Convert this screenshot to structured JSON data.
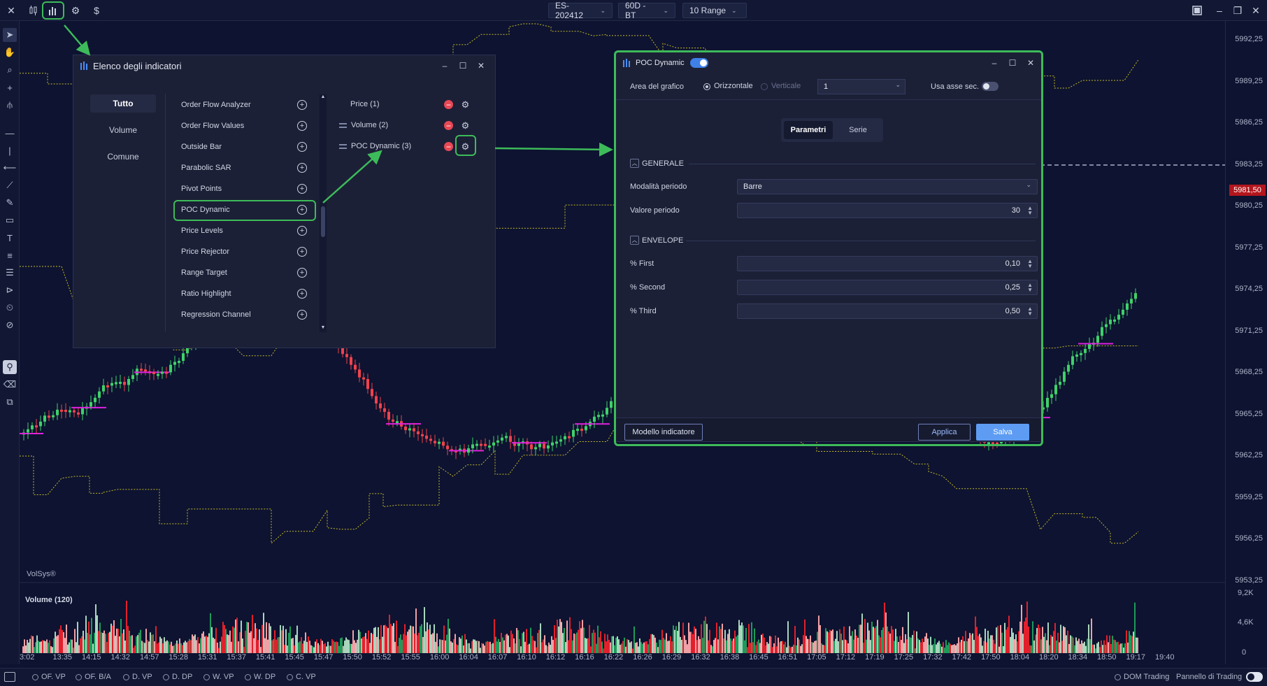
{
  "topbar": {
    "symbol": "ES-202412",
    "timeframe": "60D - BT",
    "range": "10 Range",
    "currency_icon": "$"
  },
  "indicator_list": {
    "title": "Elenco degli indicatori",
    "categories": [
      "Tutto",
      "Volume",
      "Comune"
    ],
    "items": [
      "Order Flow Analyzer",
      "Order Flow Values",
      "Outside Bar",
      "Parabolic SAR",
      "Pivot Points",
      "POC Dynamic",
      "Price Levels",
      "Price Rejector",
      "Range Target",
      "Ratio Highlight",
      "Regression Channel"
    ],
    "active": [
      "Price (1)",
      "Volume (2)",
      "POC Dynamic (3)"
    ]
  },
  "poc_dialog": {
    "title": "POC Dynamic",
    "area_label": "Area del grafico",
    "orientation_h": "Orizzontale",
    "orientation_v": "Verticale",
    "area_value": "1",
    "use_secondary_axis": "Usa asse sec.",
    "tab_params": "Parametri",
    "tab_series": "Serie",
    "section_general": "GENERALE",
    "period_mode_label": "Modalità periodo",
    "period_mode_value": "Barre",
    "period_value_label": "Valore periodo",
    "period_value": "30",
    "section_envelope": "ENVELOPE",
    "first_label": "% First",
    "first_value": "0,10",
    "second_label": "% Second",
    "second_value": "0,25",
    "third_label": "% Third",
    "third_value": "0,50",
    "template_button": "Modello indicatore",
    "apply_button": "Applica",
    "save_button": "Salva"
  },
  "price_axis": [
    "5992,25",
    "5989,25",
    "5986,25",
    "5983,25",
    "5980,25",
    "5977,25",
    "5974,25",
    "5971,25",
    "5968,25",
    "5965,25",
    "5962,25",
    "5959,25",
    "5956,25",
    "5953,25"
  ],
  "current_price": "5981,50",
  "volume_axis": [
    "9,2K",
    "4,6K",
    "0"
  ],
  "volume_title": "Volume (120)",
  "watermark": "VolSys®",
  "time_axis": [
    "3:02",
    "13:35",
    "14:15",
    "14:32",
    "14:57",
    "15:28",
    "15:31",
    "15:37",
    "15:41",
    "15:45",
    "15:47",
    "15:50",
    "15:52",
    "15:55",
    "16:00",
    "16:04",
    "16:07",
    "16:10",
    "16:12",
    "16:16",
    "16:22",
    "16:26",
    "16:29",
    "16:32",
    "16:38",
    "16:45",
    "16:51",
    "17:05",
    "17:12",
    "17:19",
    "17:25",
    "17:32",
    "17:42",
    "17:50",
    "18:04",
    "18:20",
    "18:34",
    "18:50",
    "19:17",
    "19:40"
  ],
  "bottombar": {
    "items": [
      "OF. VP",
      "OF. B/A",
      "D. VP",
      "D. DP",
      "W. VP",
      "W. DP",
      "C. VP"
    ],
    "dom_trading": "DOM Trading",
    "trading_panel": "Pannello di Trading"
  },
  "colors": {
    "background": "#0d1330",
    "up": "#3fd16a",
    "down": "#f0424c",
    "poc": "#e020e0",
    "envelope": "#c8b82a",
    "accent": "#3dbb5a"
  }
}
